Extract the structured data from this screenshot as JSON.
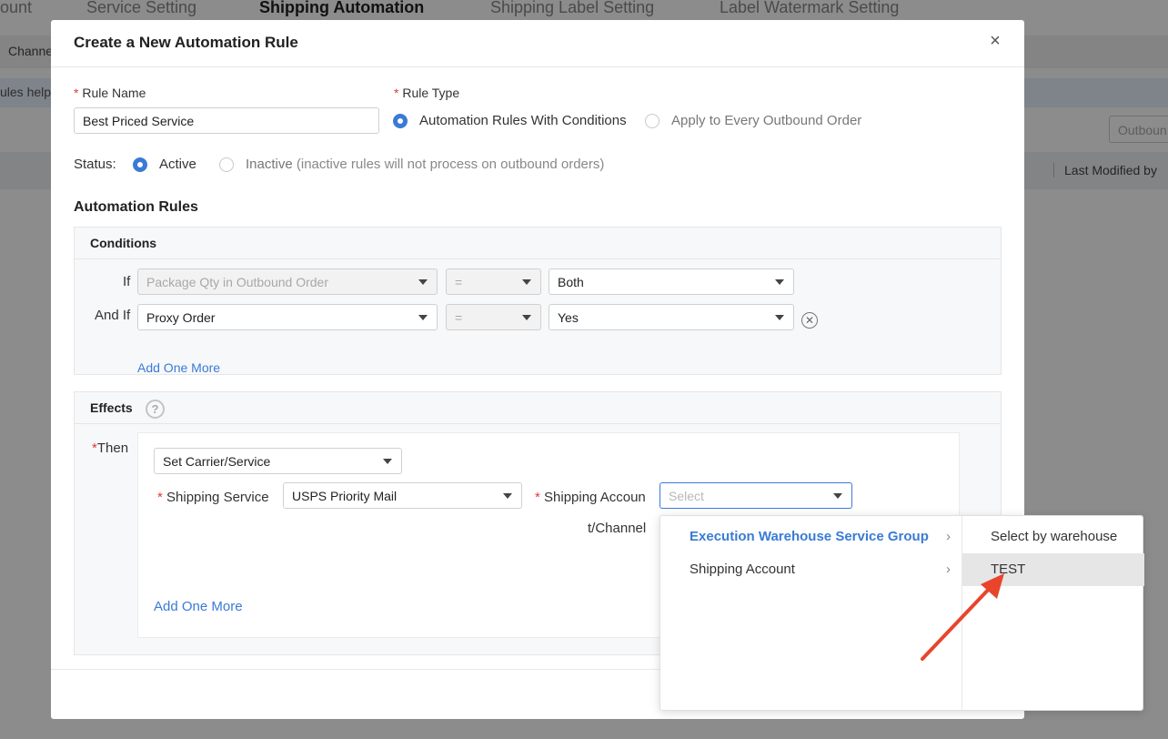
{
  "background": {
    "tabs": [
      "ount",
      "Service Setting",
      "Shipping Automation",
      "Shipping Label Setting",
      "Label Watermark Setting"
    ],
    "bar_text": "Channe",
    "note_text": "ules help",
    "outbound_placeholder": "Outboun",
    "last_modified_header": "Last Modified by"
  },
  "modal": {
    "title": "Create a New Automation Rule",
    "close_icon": "×",
    "rule_name": {
      "label": "Rule Name",
      "value": "Best Priced Service"
    },
    "rule_type": {
      "label": "Rule Type",
      "options": [
        "Automation Rules With Conditions",
        "Apply to Every Outbound Order"
      ],
      "selected": "Automation Rules With Conditions"
    },
    "status": {
      "label": "Status:",
      "active_label": "Active",
      "inactive_label": "Inactive",
      "inactive_hint": "(inactive rules will not process on outbound orders)",
      "selected": "Active"
    },
    "automation_rules_title": "Automation Rules",
    "conditions": {
      "title": "Conditions",
      "rows": [
        {
          "prefix": "If",
          "field": "Package Qty in Outbound Order",
          "operator": "=",
          "value": "Both",
          "field_disabled": true
        },
        {
          "prefix": "And If",
          "field": "Proxy Order",
          "operator": "=",
          "value": "Yes",
          "field_disabled": false
        }
      ],
      "add_more": "Add One More"
    },
    "effects": {
      "title": "Effects",
      "help_icon": "?",
      "then_label": "Then",
      "action": "Set Carrier/Service",
      "shipping_service_label": "Shipping Service",
      "shipping_service_value": "USPS Priority Mail",
      "shipping_account_label_1": "Shipping Accoun",
      "shipping_account_label_2": "t/Channel",
      "shipping_account_placeholder": "Select",
      "add_more": "Add One More"
    }
  },
  "cascader": {
    "column1": [
      {
        "label": "Execution Warehouse Service Group",
        "active": true
      },
      {
        "label": "Shipping Account",
        "active": false
      }
    ],
    "column2": [
      {
        "label": "Select by warehouse",
        "hover": false
      },
      {
        "label": "TEST",
        "hover": true
      }
    ],
    "chevron": "›"
  },
  "colors": {
    "accent": "#3a7bd5",
    "required": "#e03a3a",
    "annotation_arrow": "#e8452c"
  }
}
